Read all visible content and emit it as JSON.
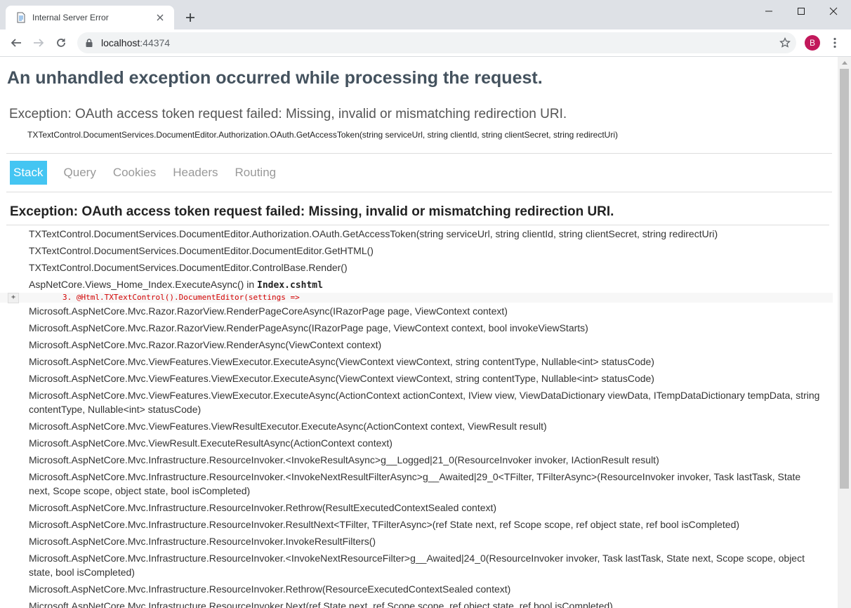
{
  "browser": {
    "tab_title": "Internal Server Error",
    "url_host": "localhost",
    "url_port": ":44374",
    "profile_initial": "B"
  },
  "page": {
    "title": "An unhandled exception occurred while processing the request.",
    "exception_summary": "Exception: OAuth access token request failed: Missing, invalid or mismatching redirection URI.",
    "exception_location": "TXTextControl.DocumentServices.DocumentEditor.Authorization.OAuth.GetAccessToken(string serviceUrl, string clientId, string clientSecret, string redirectUri)",
    "tabs": [
      {
        "label": "Stack",
        "active": true
      },
      {
        "label": "Query",
        "active": false
      },
      {
        "label": "Cookies",
        "active": false
      },
      {
        "label": "Headers",
        "active": false
      },
      {
        "label": "Routing",
        "active": false
      }
    ],
    "stack_title": "Exception: OAuth access token request failed: Missing, invalid or mismatching redirection URI.",
    "frames": [
      "TXTextControl.DocumentServices.DocumentEditor.Authorization.OAuth.GetAccessToken(string serviceUrl, string clientId, string clientSecret, string redirectUri)",
      "TXTextControl.DocumentServices.DocumentEditor.DocumentEditor.GetHTML()",
      "TXTextControl.DocumentServices.DocumentEditor.ControlBase.Render()"
    ],
    "razor_frame": {
      "method": "AspNetCore.Views_Home_Index.ExecuteAsync() in ",
      "file": "Index.cshtml",
      "expander": "+",
      "line_number": "3.",
      "code": "@Html.TXTextControl().DocumentEditor(settings =>"
    },
    "frames_after": [
      "Microsoft.AspNetCore.Mvc.Razor.RazorView.RenderPageCoreAsync(IRazorPage page, ViewContext context)",
      "Microsoft.AspNetCore.Mvc.Razor.RazorView.RenderPageAsync(IRazorPage page, ViewContext context, bool invokeViewStarts)",
      "Microsoft.AspNetCore.Mvc.Razor.RazorView.RenderAsync(ViewContext context)",
      "Microsoft.AspNetCore.Mvc.ViewFeatures.ViewExecutor.ExecuteAsync(ViewContext viewContext, string contentType, Nullable<int> statusCode)",
      "Microsoft.AspNetCore.Mvc.ViewFeatures.ViewExecutor.ExecuteAsync(ViewContext viewContext, string contentType, Nullable<int> statusCode)",
      "Microsoft.AspNetCore.Mvc.ViewFeatures.ViewExecutor.ExecuteAsync(ActionContext actionContext, IView view, ViewDataDictionary viewData, ITempDataDictionary tempData, string contentType, Nullable<int> statusCode)",
      "Microsoft.AspNetCore.Mvc.ViewFeatures.ViewResultExecutor.ExecuteAsync(ActionContext context, ViewResult result)",
      "Microsoft.AspNetCore.Mvc.ViewResult.ExecuteResultAsync(ActionContext context)",
      "Microsoft.AspNetCore.Mvc.Infrastructure.ResourceInvoker.<InvokeResultAsync>g__Logged|21_0(ResourceInvoker invoker, IActionResult result)",
      "Microsoft.AspNetCore.Mvc.Infrastructure.ResourceInvoker.<InvokeNextResultFilterAsync>g__Awaited|29_0<TFilter, TFilterAsync>(ResourceInvoker invoker, Task lastTask, State next, Scope scope, object state, bool isCompleted)",
      "Microsoft.AspNetCore.Mvc.Infrastructure.ResourceInvoker.Rethrow(ResultExecutedContextSealed context)",
      "Microsoft.AspNetCore.Mvc.Infrastructure.ResourceInvoker.ResultNext<TFilter, TFilterAsync>(ref State next, ref Scope scope, ref object state, ref bool isCompleted)",
      "Microsoft.AspNetCore.Mvc.Infrastructure.ResourceInvoker.InvokeResultFilters()",
      "Microsoft.AspNetCore.Mvc.Infrastructure.ResourceInvoker.<InvokeNextResourceFilter>g__Awaited|24_0(ResourceInvoker invoker, Task lastTask, State next, Scope scope, object state, bool isCompleted)",
      "Microsoft.AspNetCore.Mvc.Infrastructure.ResourceInvoker.Rethrow(ResourceExecutedContextSealed context)",
      "Microsoft.AspNetCore.Mvc.Infrastructure.ResourceInvoker.Next(ref State next, ref Scope scope, ref object state, ref bool isCompleted)"
    ]
  },
  "colors": {
    "active_tab": "#44c5f2",
    "title": "#44525e",
    "code_red": "#d20000",
    "avatar": "#c2185b"
  }
}
